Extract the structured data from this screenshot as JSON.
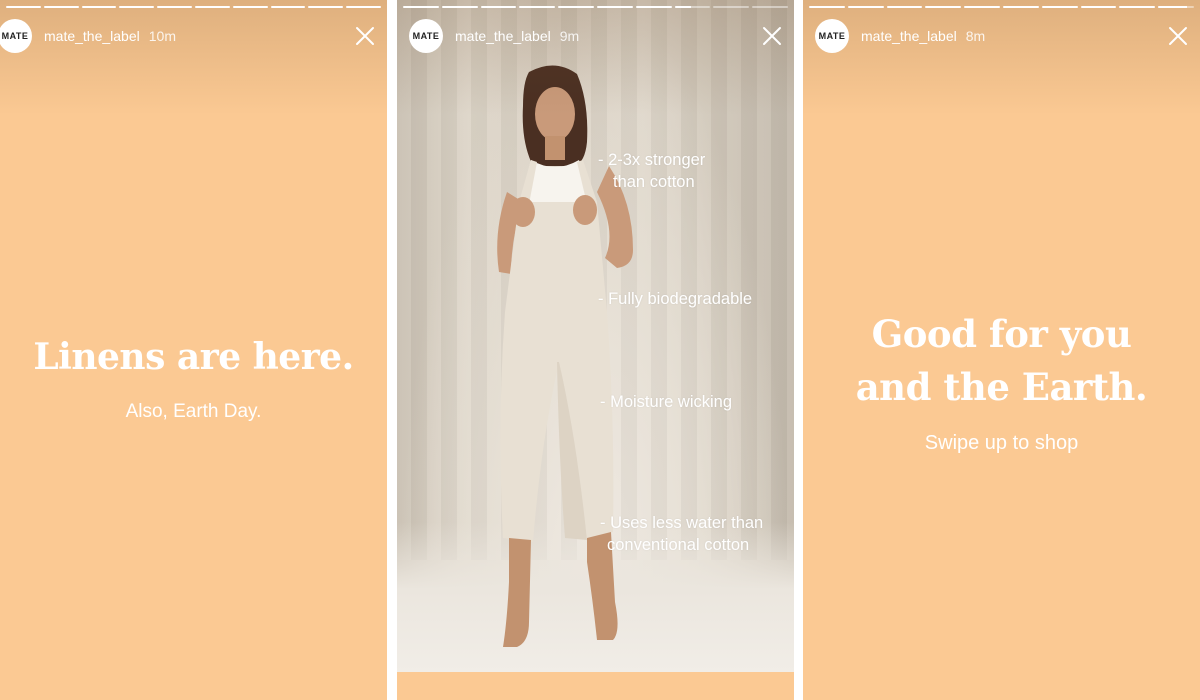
{
  "stories": [
    {
      "username": "mate_the_label",
      "time": "10m",
      "avatar_text": "MATE",
      "progress": [
        1,
        1,
        1,
        1,
        1,
        1,
        1,
        1,
        1,
        1
      ],
      "headline": "Linens are here.",
      "subtext": "Also, Earth Day."
    },
    {
      "username": "mate_the_label",
      "time": "9m",
      "avatar_text": "MATE",
      "progress": [
        1,
        1,
        1,
        1,
        1,
        1,
        1,
        0.45,
        0,
        0
      ],
      "features": {
        "f1_line1": "- 2-3x stronger",
        "f1_line2": "than cotton",
        "f2": "- Fully biodegradable",
        "f3": "- Moisture wicking",
        "f4_line1": "- Uses less water than",
        "f4_line2": "conventional cotton"
      }
    },
    {
      "username": "mate_the_label",
      "time": "8m",
      "avatar_text": "MATE",
      "progress": [
        1,
        1,
        1,
        1,
        1,
        1,
        1,
        1,
        1,
        0.8
      ],
      "headline_line1": "Good for you",
      "headline_line2": "and the Earth.",
      "subtext": "Swipe up to shop"
    }
  ],
  "colors": {
    "background": "#fbc993",
    "text": "#ffffff"
  },
  "icons": {
    "close": "close-icon"
  }
}
